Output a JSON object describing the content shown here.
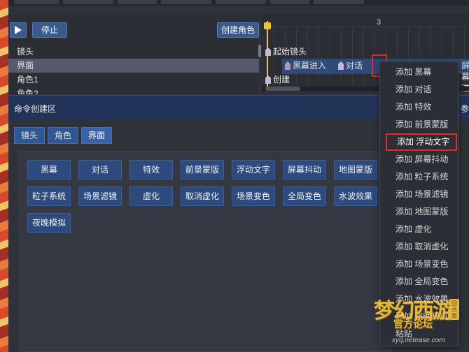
{
  "top_bar": {
    "tabs": [
      "",
      "",
      "",
      "",
      "",
      "",
      ""
    ]
  },
  "left_panel": {
    "stop_label": "停止",
    "create_role_label": "创建角色",
    "tracks": [
      {
        "label": "镜头",
        "selected": false
      },
      {
        "label": "界面",
        "selected": true
      },
      {
        "label": "角色1",
        "selected": false
      },
      {
        "label": "角色2",
        "selected": false
      }
    ]
  },
  "timeline": {
    "ruler_number": "3",
    "events": {
      "start_camera": "起始镜头",
      "black_screen_enter": "黑幕进入",
      "dialogue": "对话",
      "create": "创建",
      "screen_enter_partial": "屏幕进入"
    }
  },
  "command_area": {
    "title": "命令创建区",
    "right_partial": "参",
    "tabs": [
      {
        "label": "镜头",
        "active": false
      },
      {
        "label": "角色",
        "active": false
      },
      {
        "label": "界面",
        "active": true
      }
    ],
    "buttons": [
      "黑幕",
      "对话",
      "特效",
      "前景蒙版",
      "浮动文字",
      "屏幕抖动",
      "地图蒙版",
      "粒子系统",
      "场景滤镜",
      "虚化",
      "取消虚化",
      "场景变色",
      "全局变色",
      "水波效果",
      "夜晚模拟"
    ]
  },
  "context_menu": {
    "highlighted_index": 4,
    "items": [
      "添加 黑幕",
      "添加 对话",
      "添加 特效",
      "添加 前景蒙版",
      "添加 浮动文字",
      "添加 屏幕抖动",
      "添加 粒子系统",
      "添加 场景滤镜",
      "添加 地图蒙版",
      "添加 虚化",
      "添加 取消虚化",
      "添加 场景变色",
      "添加 全局变色",
      "添加 水波效果",
      "添加 夜晚模拟",
      "粘贴"
    ]
  },
  "watermark": {
    "title": "梦幻西游",
    "sub": "官方论坛",
    "badge": "回合版",
    "url": "xyq.netease.com"
  },
  "colors": {
    "accent_blue": "#2c4a7d",
    "header_blue": "#233358",
    "highlight_red": "#e02b2b",
    "playhead_yellow": "#f2c230"
  }
}
